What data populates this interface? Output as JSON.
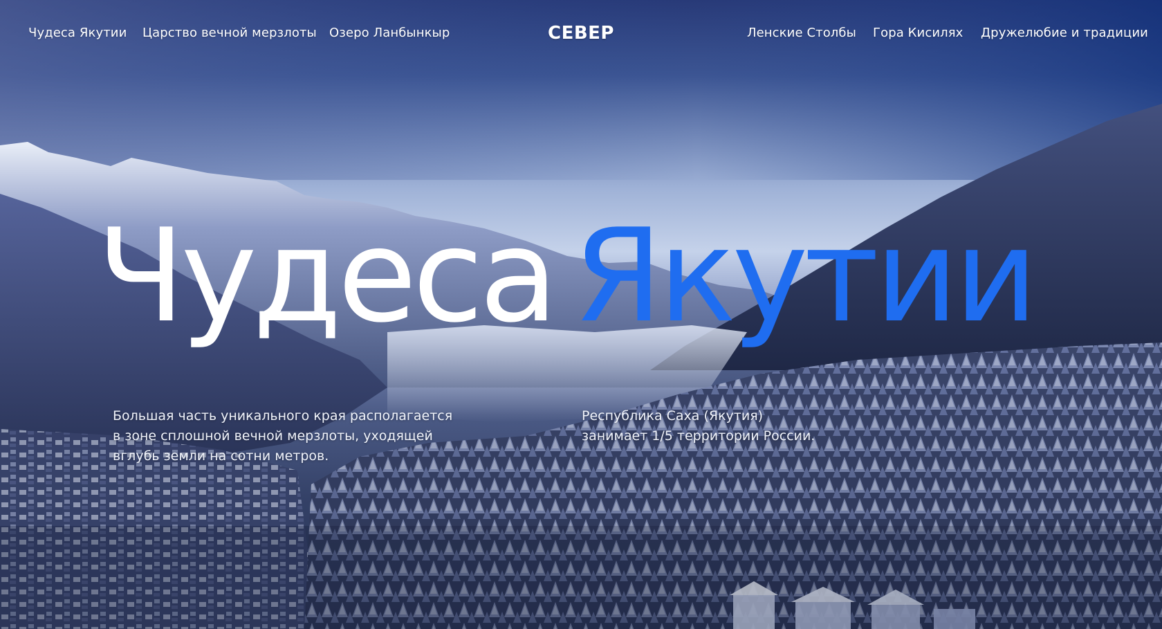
{
  "nav": {
    "brand": "СЕВЕР",
    "left_links": [
      {
        "label": "Чудеса Якутии"
      },
      {
        "label": "Царство вечной мерзлоты"
      },
      {
        "label": "Озеро Ланбынкыр"
      }
    ],
    "right_links": [
      {
        "label": "Ленские Столбы"
      },
      {
        "label": "Гора Кисилях"
      },
      {
        "label": "Дружелюбие и традиции"
      }
    ]
  },
  "hero": {
    "title_part1": "Чудеса",
    "title_part2": "Якутии",
    "accent_color": "#1f6df0",
    "caption_left": [
      "Большая часть уникального края располагается",
      "в зоне сплошной вечной мерзлоты, уходящей",
      "вглубь земли на сотни метров."
    ],
    "caption_right": [
      "Республика Саха (Якутия)",
      "занимает 1/5 территории России."
    ]
  }
}
